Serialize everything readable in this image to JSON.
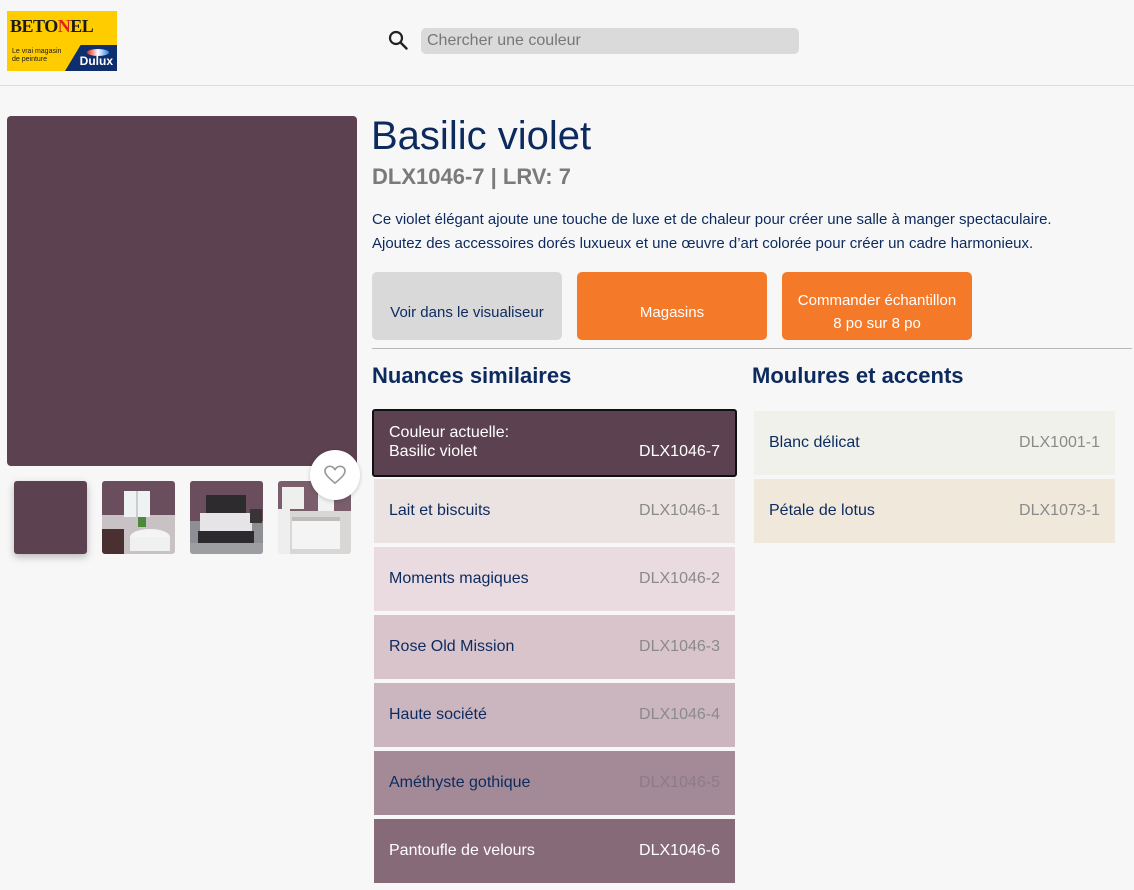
{
  "header": {
    "logo": {
      "brand_a": "BETO",
      "brand_b": "N",
      "brand_c": "EL",
      "tagline": "Le vrai magasin de peinture",
      "partner": "Dulux"
    },
    "search": {
      "placeholder": "Chercher une couleur",
      "icon": "search-icon"
    }
  },
  "color": {
    "name": "Basilic violet",
    "subtitle": "DLX1046-7 | LRV: 7",
    "hex": "#5c4150",
    "description_1": "Ce violet élégant ajoute une touche de luxe et de chaleur pour créer une salle à manger spectaculaire.",
    "description_2": "Ajoutez des accessoires dorés luxueux et une œuvre d’art colorée pour créer un cadre harmonieux."
  },
  "actions": {
    "visualiser": "Voir dans le visualiseur",
    "stores": "Magasins",
    "order_l1": "Commander échantillon",
    "order_l2": "8 po sur 8 po",
    "accent": "#f47a2a"
  },
  "favorite_icon": "heart-icon",
  "similar": {
    "title": "Nuances similaires",
    "current_label": "Couleur actuelle:",
    "items": [
      {
        "name": "Basilic violet",
        "code": "DLX1046-7",
        "hex": "#5c4150"
      },
      {
        "name": "Lait et biscuits",
        "code": "DLX1046-1",
        "hex": "#ebe2e2"
      },
      {
        "name": "Moments magiques",
        "code": "DLX1046-2",
        "hex": "#e9dbe0"
      },
      {
        "name": "Rose Old Mission",
        "code": "DLX1046-3",
        "hex": "#d9c4cc"
      },
      {
        "name": "Haute société",
        "code": "DLX1046-4",
        "hex": "#cbb6c0"
      },
      {
        "name": "Améthyste gothique",
        "code": "DLX1046-5",
        "hex": "#a48a97"
      },
      {
        "name": "Pantoufle de velours",
        "code": "DLX1046-6",
        "hex": "#866a78"
      }
    ]
  },
  "trims": {
    "title": "Moulures et accents",
    "items": [
      {
        "name": "Blanc délicat",
        "code": "DLX1001-1",
        "hex": "#f1f1ec"
      },
      {
        "name": "Pétale de lotus",
        "code": "DLX1073-1",
        "hex": "#f1e8dc"
      }
    ]
  }
}
